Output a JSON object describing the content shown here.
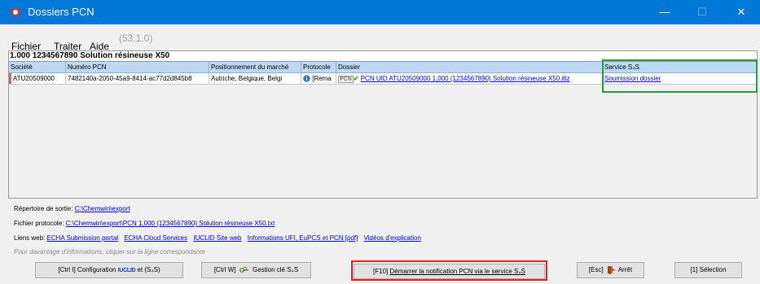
{
  "window": {
    "title": "Dossiers PCN",
    "minimize_glyph": "—",
    "maximize_glyph": "☐",
    "close_glyph": "✕"
  },
  "menu": {
    "file": "Fichier",
    "process": "Traiter",
    "help": "Aide",
    "version": "(53.1.0)"
  },
  "heading": "1.000 1234567890 Solution résineuse X50",
  "table": {
    "columns": [
      "Société",
      "Numéro PCN",
      "Positionnement du marché",
      "Protocole",
      "Dossier",
      "Service S₄S"
    ],
    "row": {
      "societe": "ATU20509000",
      "numero": "7482140a-2050-45a9-8414-ac77d2d845b8",
      "marche": "Autriche, Belgique, Belgi",
      "protocole": "[Rema",
      "dossier_badge": "PCN",
      "dossier": "PCN UID ATU20509000 1,000 (1234567890) Solution résineuse X50.i6z",
      "service": "Soumission dossier"
    }
  },
  "info": {
    "output_label": "Répertoire de sortie:",
    "output_path": "C:\\Chemwin\\export",
    "protocol_label": "Fichier protocole:",
    "protocol_path": "C:\\Chemwin\\export\\PCN 1,000 (1234567890) Solution résineuse X50.txt",
    "web_label": "Liens web:",
    "web_links": [
      "ECHA Submission portal",
      "ECHA Cloud Services",
      "IUCLID Site web",
      "Informations UFI, EuPCS et PCN [pdf]",
      "Vidéos d'explication"
    ],
    "hint": "Pour davantage d'informations, cliquer sur la ligne correspondante"
  },
  "buttons": {
    "config_prefix": "[Ctrl I] Configuration",
    "config_logo": "IUCLID",
    "config_suffix": "et (S₄S)",
    "key_mgmt": "[Ctrl W]",
    "key_mgmt_label": "Gestion clé S₄S",
    "start_key": "[F10]",
    "start_label": "Démarrer la notification PCN via le service S₄S",
    "stop": "[Esc]",
    "stop_label": "Arrêt",
    "select": "[1] Sélection"
  },
  "colors": {
    "titlebar": "#0078d7",
    "header_row": "#bcd8f2",
    "highlight_green": "#22a040",
    "highlight_red": "#e0202a"
  },
  "icons": [
    "app-logo-icon",
    "info-icon",
    "pcn-check-icon",
    "key-icon",
    "door-exit-icon"
  ]
}
